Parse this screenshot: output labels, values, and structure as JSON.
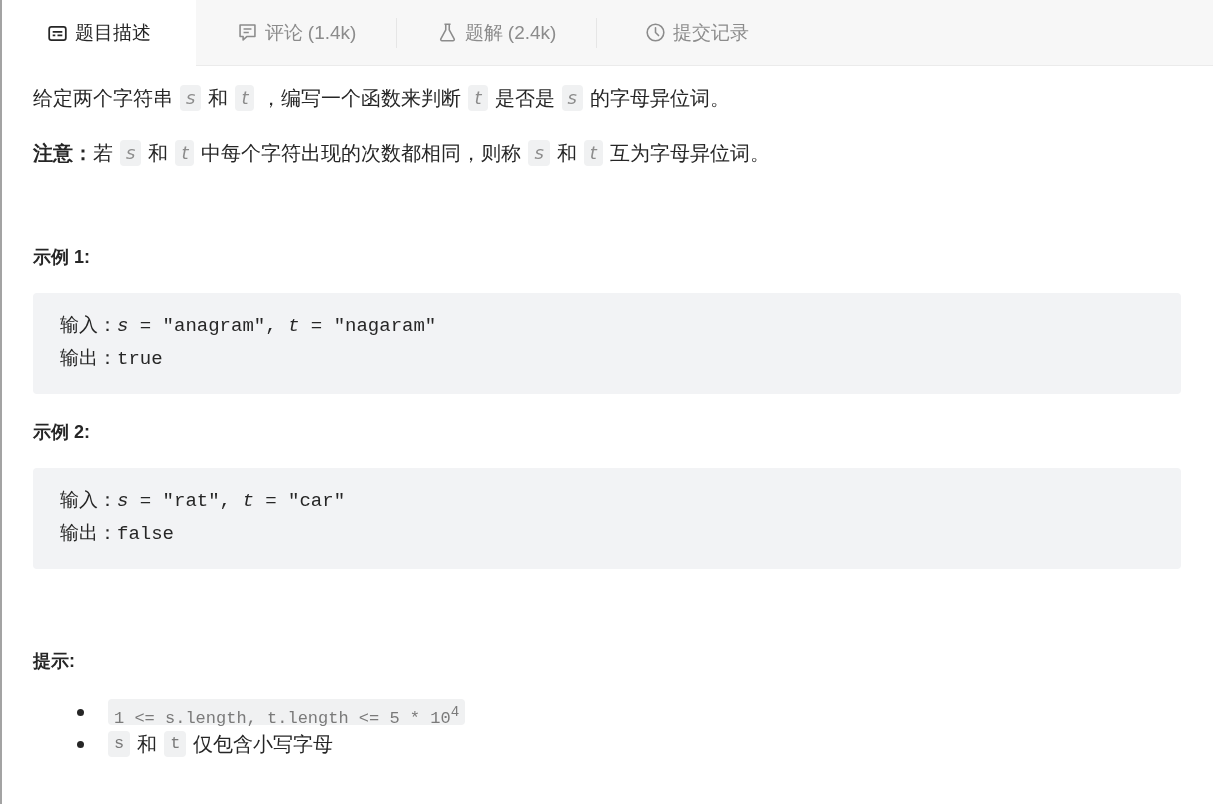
{
  "tabs": [
    {
      "label": "题目描述",
      "selected": true
    },
    {
      "label": "评论 (1.4k)",
      "selected": false
    },
    {
      "label": "题解 (2.4k)",
      "selected": false
    },
    {
      "label": "提交记录",
      "selected": false
    }
  ],
  "description": {
    "paragraphs": [
      {
        "parts": [
          {
            "kind": "text",
            "text": "给定两个字符串"
          },
          {
            "kind": "var",
            "text": "s"
          },
          {
            "kind": "text",
            "text": "和"
          },
          {
            "kind": "var",
            "text": "t"
          },
          {
            "kind": "text",
            "text": "，编写一个函数来判断"
          },
          {
            "kind": "var",
            "text": "t"
          },
          {
            "kind": "text",
            "text": "是否是"
          },
          {
            "kind": "var",
            "text": "s"
          },
          {
            "kind": "text",
            "text": "的字母异位词。"
          }
        ]
      },
      {
        "parts": [
          {
            "kind": "bold",
            "text": "注意："
          },
          {
            "kind": "text",
            "text": "若"
          },
          {
            "kind": "var",
            "text": "s"
          },
          {
            "kind": "text",
            "text": "和"
          },
          {
            "kind": "var",
            "text": "t"
          },
          {
            "kind": "text",
            "text": "中每个字符出现的次数都相同，则称"
          },
          {
            "kind": "var",
            "text": "s"
          },
          {
            "kind": "text",
            "text": "和"
          },
          {
            "kind": "var",
            "text": "t"
          },
          {
            "kind": "text",
            "text": "互为字母异位词。"
          }
        ]
      }
    ],
    "examples": [
      {
        "title": "示例 1:",
        "lines": [
          "输入：*s* = \"anagram\", *t* = \"nagaram\"",
          "输出：true"
        ]
      },
      {
        "title": "示例 2:",
        "lines": [
          "输入：*s* = \"rat\", *t* = \"car\"",
          "输出：false"
        ]
      }
    ],
    "hints": {
      "title": "提示:",
      "items": [
        {
          "parts": [
            {
              "kind": "code",
              "text": "1 <= s.length, t.length <= 5 * 10$^{4}$"
            }
          ]
        },
        {
          "parts": [
            {
              "kind": "code",
              "text": "s"
            },
            {
              "kind": "text",
              "text": "和"
            },
            {
              "kind": "code",
              "text": "t"
            },
            {
              "kind": "text",
              "text": "仅包含小写字母"
            }
          ]
        }
      ]
    }
  }
}
